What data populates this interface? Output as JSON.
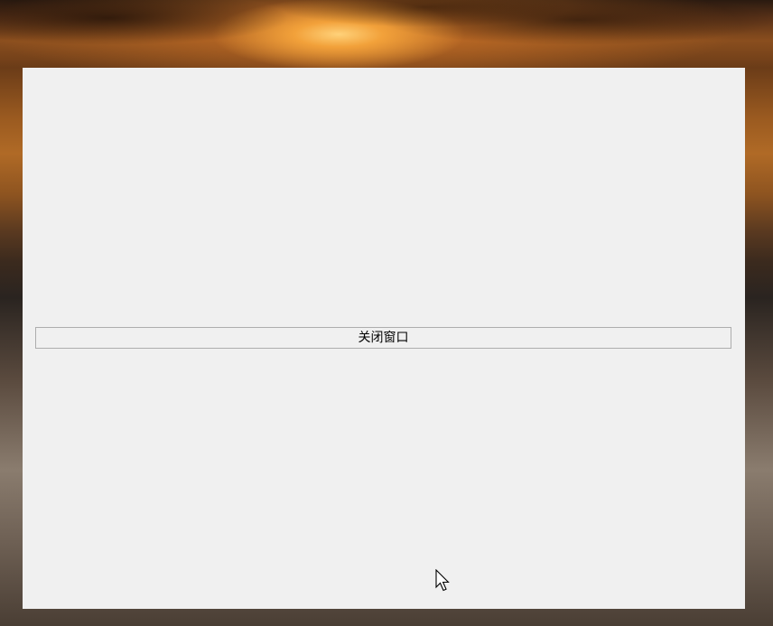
{
  "desktop": {
    "wallpaper": "sunset-albatross-colony"
  },
  "window": {
    "background_color": "#f0f0f0",
    "close_button_label": "关闭窗口"
  },
  "cursor": {
    "icon": "arrow-cursor-icon"
  }
}
